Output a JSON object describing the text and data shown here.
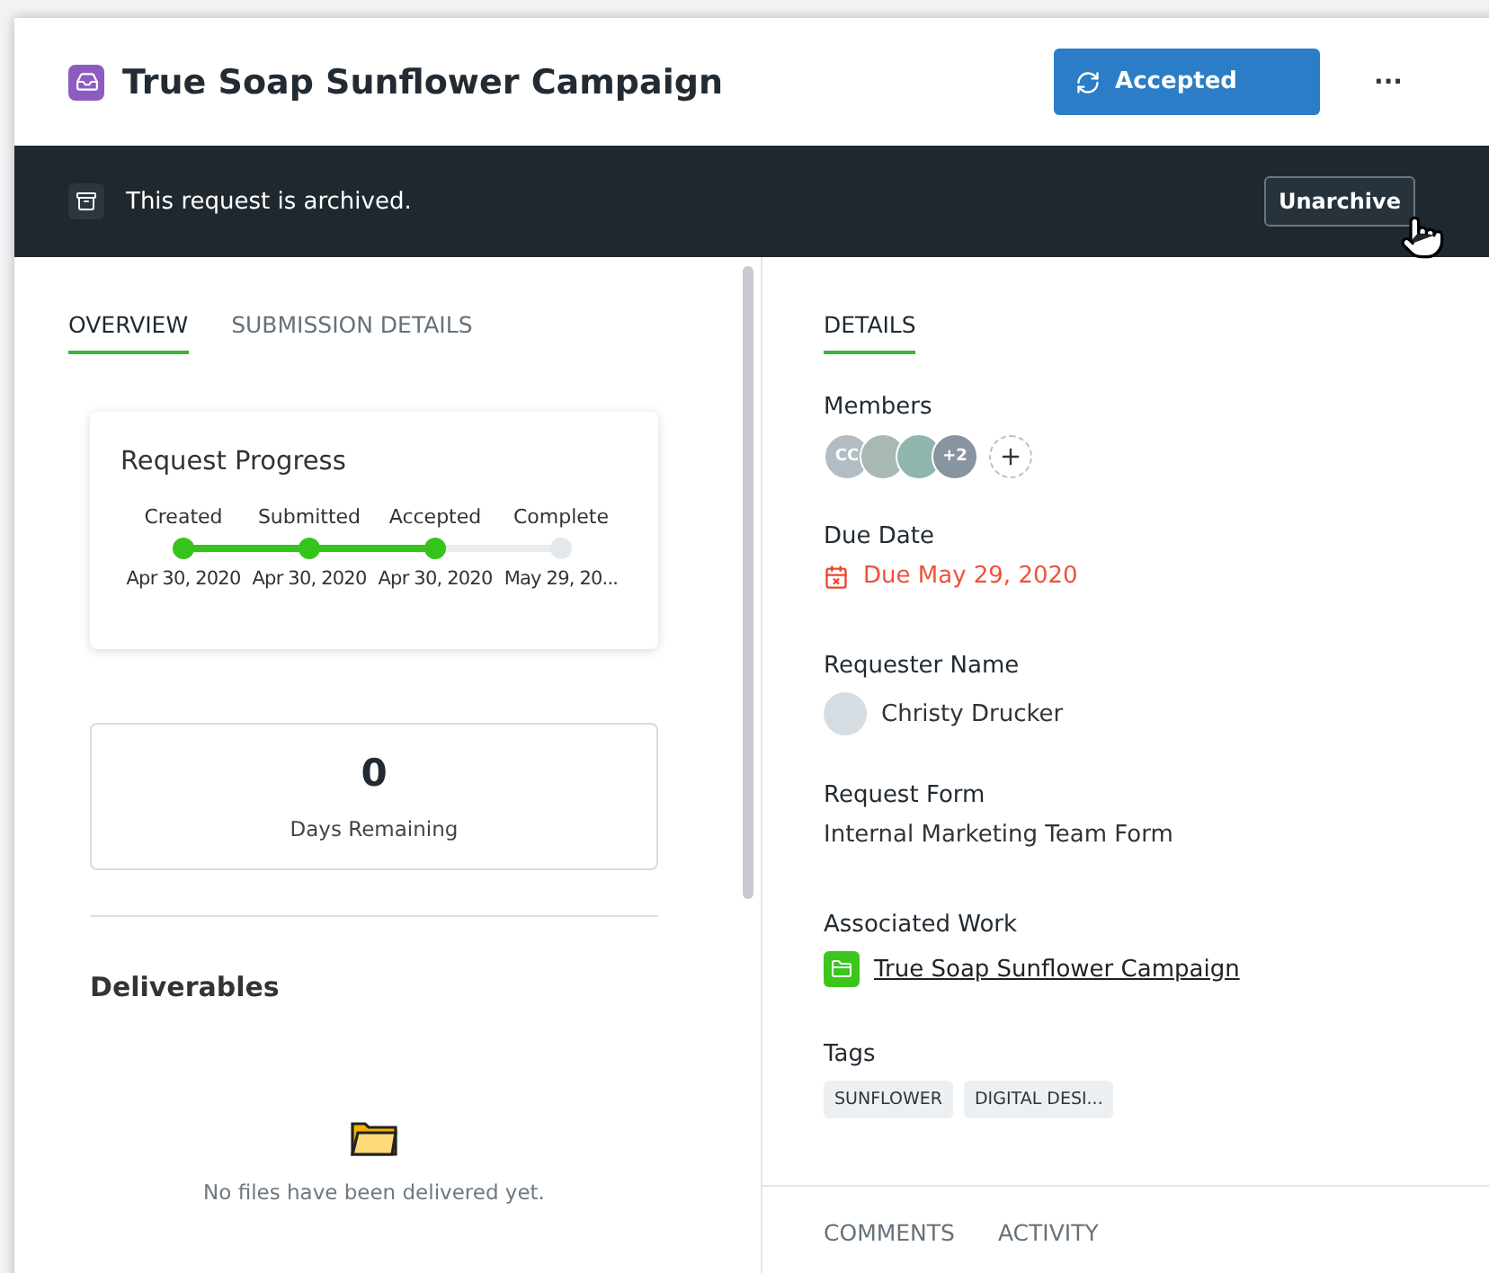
{
  "header": {
    "title": "True Soap Sunflower Campaign",
    "status_button": "Accepted",
    "more_button": "···"
  },
  "banner": {
    "message": "This request is archived.",
    "button": "Unarchive"
  },
  "left_tabs": [
    {
      "label": "OVERVIEW",
      "selected": true
    },
    {
      "label": "SUBMISSION DETAILS",
      "selected": false
    }
  ],
  "progress": {
    "title": "Request Progress",
    "steps": [
      {
        "label": "Created",
        "date": "Apr 30, 2020",
        "done": true
      },
      {
        "label": "Submitted",
        "date": "Apr 30, 2020",
        "done": true
      },
      {
        "label": "Accepted",
        "date": "Apr 30, 2020",
        "done": true
      },
      {
        "label": "Complete",
        "date": "May 29, 20...",
        "done": false
      }
    ]
  },
  "days": {
    "value": "0",
    "label": "Days Remaining"
  },
  "deliverables": {
    "title": "Deliverables",
    "empty_text": "No files have been delivered yet."
  },
  "right_tabs": [
    {
      "label": "DETAILS",
      "selected": true
    }
  ],
  "details": {
    "members": {
      "label": "Members",
      "avatars": [
        {
          "kind": "initials",
          "text": "CC"
        },
        {
          "kind": "photo"
        },
        {
          "kind": "photo"
        },
        {
          "kind": "count",
          "text": "+2"
        },
        {
          "kind": "add"
        }
      ]
    },
    "due_date": {
      "label": "Due Date",
      "value": "Due May 29, 2020",
      "overdue": true
    },
    "requester": {
      "label": "Requester Name",
      "value": "Christy Drucker"
    },
    "request_form": {
      "label": "Request Form",
      "value": "Internal Marketing Team Form"
    },
    "associated_work": {
      "label": "Associated Work",
      "value": "True Soap Sunflower Campaign"
    },
    "tags": {
      "label": "Tags",
      "items": [
        "SUNFLOWER",
        "DIGITAL DESI..."
      ]
    }
  },
  "bottom_tabs": [
    {
      "label": "COMMENTS",
      "selected": false
    },
    {
      "label": "ACTIVITY",
      "selected": false
    }
  ]
}
